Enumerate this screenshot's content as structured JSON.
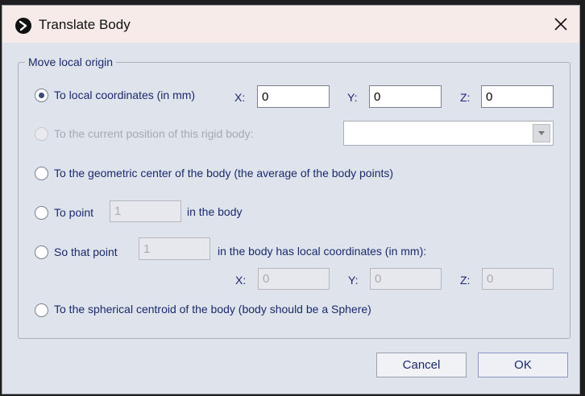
{
  "window": {
    "title": "Translate Body"
  },
  "group": {
    "legend": "Move local origin"
  },
  "options": {
    "local_coords": {
      "label": "To local coordinates (in mm)",
      "x_label": "X:",
      "y_label": "Y:",
      "z_label": "Z:",
      "x": "0",
      "y": "0",
      "z": "0"
    },
    "current_position": {
      "label": "To the current position of this rigid body:",
      "selected": ""
    },
    "geometric_center": {
      "label": "To the geometric center of the body (the average of the body points)"
    },
    "to_point": {
      "label": "To point",
      "value": "1",
      "suffix": "in the body"
    },
    "so_that_point": {
      "label": "So that point",
      "value": "1",
      "suffix": "in the body has local coordinates (in mm):",
      "x_label": "X:",
      "y_label": "Y:",
      "z_label": "Z:",
      "x": "0",
      "y": "0",
      "z": "0"
    },
    "spherical_centroid": {
      "label": "To the spherical centroid of the body (body should be a Sphere)"
    }
  },
  "buttons": {
    "cancel": "Cancel",
    "ok": "OK"
  },
  "icons": {
    "app": "app-logo-icon",
    "close": "close-icon",
    "dropdown": "chevron-down-icon"
  }
}
